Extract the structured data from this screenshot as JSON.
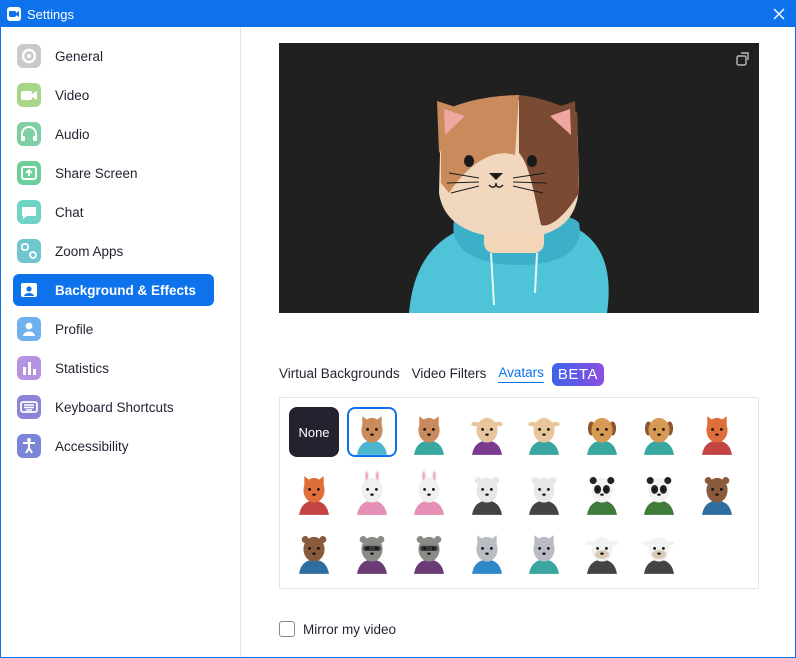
{
  "window": {
    "title": "Settings"
  },
  "sidebar": {
    "items": [
      {
        "label": "General",
        "icon": "gear-icon",
        "color": "#c9c9c9"
      },
      {
        "label": "Video",
        "icon": "video-camera-icon",
        "color": "#a7d58a"
      },
      {
        "label": "Audio",
        "icon": "headphones-icon",
        "color": "#7fcfa4"
      },
      {
        "label": "Share Screen",
        "icon": "share-screen-icon",
        "color": "#6ccf9a"
      },
      {
        "label": "Chat",
        "icon": "chat-bubble-icon",
        "color": "#6fd3c6"
      },
      {
        "label": "Zoom Apps",
        "icon": "apps-icon",
        "color": "#6fc6cf"
      },
      {
        "label": "Background & Effects",
        "icon": "person-background-icon",
        "color": "#0e72ed"
      },
      {
        "label": "Profile",
        "icon": "person-icon",
        "color": "#6fb1ef"
      },
      {
        "label": "Statistics",
        "icon": "bar-chart-icon",
        "color": "#b493e0"
      },
      {
        "label": "Keyboard Shortcuts",
        "icon": "keyboard-icon",
        "color": "#8b84d9"
      },
      {
        "label": "Accessibility",
        "icon": "accessibility-icon",
        "color": "#7b86d8"
      }
    ],
    "active_index": 6
  },
  "main": {
    "tabs": [
      {
        "label": "Virtual Backgrounds",
        "active": false
      },
      {
        "label": "Video Filters",
        "active": false
      },
      {
        "label": "Avatars",
        "active": true
      }
    ],
    "beta_badge": "BETA",
    "none_label": "None",
    "avatars": [
      {
        "name": "cat-calico",
        "color": "#c98a5c",
        "shirt": "#4cb5d0"
      },
      {
        "name": "cat-calico",
        "color": "#c98a5c",
        "shirt": "#3aa6a0"
      },
      {
        "name": "cow-tan",
        "color": "#e6c69a",
        "shirt": "#7a3b8f"
      },
      {
        "name": "cow-tan",
        "color": "#e6c69a",
        "shirt": "#3aa6a0"
      },
      {
        "name": "dog-beagle",
        "color": "#d79a55",
        "shirt": "#3aa6a0"
      },
      {
        "name": "dog-beagle",
        "color": "#d79a55",
        "shirt": "#3aa6a0"
      },
      {
        "name": "fox",
        "color": "#e06e3b",
        "shirt": "#c44343"
      },
      {
        "name": "fox",
        "color": "#e06e3b",
        "shirt": "#c44343"
      },
      {
        "name": "rabbit",
        "color": "#f0f0f0",
        "shirt": "#e58fb5"
      },
      {
        "name": "rabbit",
        "color": "#f0f0f0",
        "shirt": "#e58fb5"
      },
      {
        "name": "polar-bear",
        "color": "#e7e7e7",
        "shirt": "#444444"
      },
      {
        "name": "polar-bear",
        "color": "#e7e7e7",
        "shirt": "#444444"
      },
      {
        "name": "panda",
        "color": "#f2f2f2",
        "shirt": "#3f7b3a"
      },
      {
        "name": "panda",
        "color": "#f2f2f2",
        "shirt": "#3f7b3a"
      },
      {
        "name": "beaver",
        "color": "#8a5a3c",
        "shirt": "#2f6fa0"
      },
      {
        "name": "beaver",
        "color": "#8a5a3c",
        "shirt": "#2f6fa0"
      },
      {
        "name": "raccoon",
        "color": "#8c8a86",
        "shirt": "#6a3b75"
      },
      {
        "name": "raccoon",
        "color": "#8c8a86",
        "shirt": "#6a3b75"
      },
      {
        "name": "cat-gray",
        "color": "#b9bcc2",
        "shirt": "#2f88c8"
      },
      {
        "name": "cat-gray",
        "color": "#b9bcc2",
        "shirt": "#3aa6a0"
      },
      {
        "name": "cow-holstein",
        "color": "#f2f2f2",
        "shirt": "#444444"
      },
      {
        "name": "cow-holstein",
        "color": "#f2f2f2",
        "shirt": "#444444"
      }
    ],
    "selected_avatar_index": 0,
    "mirror_label": "Mirror my video",
    "mirror_checked": false
  },
  "colors": {
    "accent": "#0e72ed",
    "preview_bg": "#202020"
  }
}
